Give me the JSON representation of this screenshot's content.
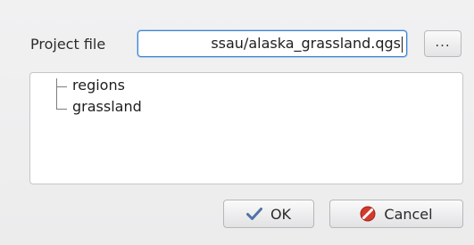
{
  "project": {
    "label": "Project file",
    "value": "ssau/alaska_grassland.qgs",
    "browse_label": "..."
  },
  "layers": [
    {
      "name": "regions"
    },
    {
      "name": "grassland"
    }
  ],
  "buttons": {
    "ok_label": "OK",
    "cancel_label": "Cancel"
  },
  "colors": {
    "focus_border": "#3a84d6",
    "ok_icon": "#4f73a8",
    "cancel_icon": "#d33a2c"
  }
}
